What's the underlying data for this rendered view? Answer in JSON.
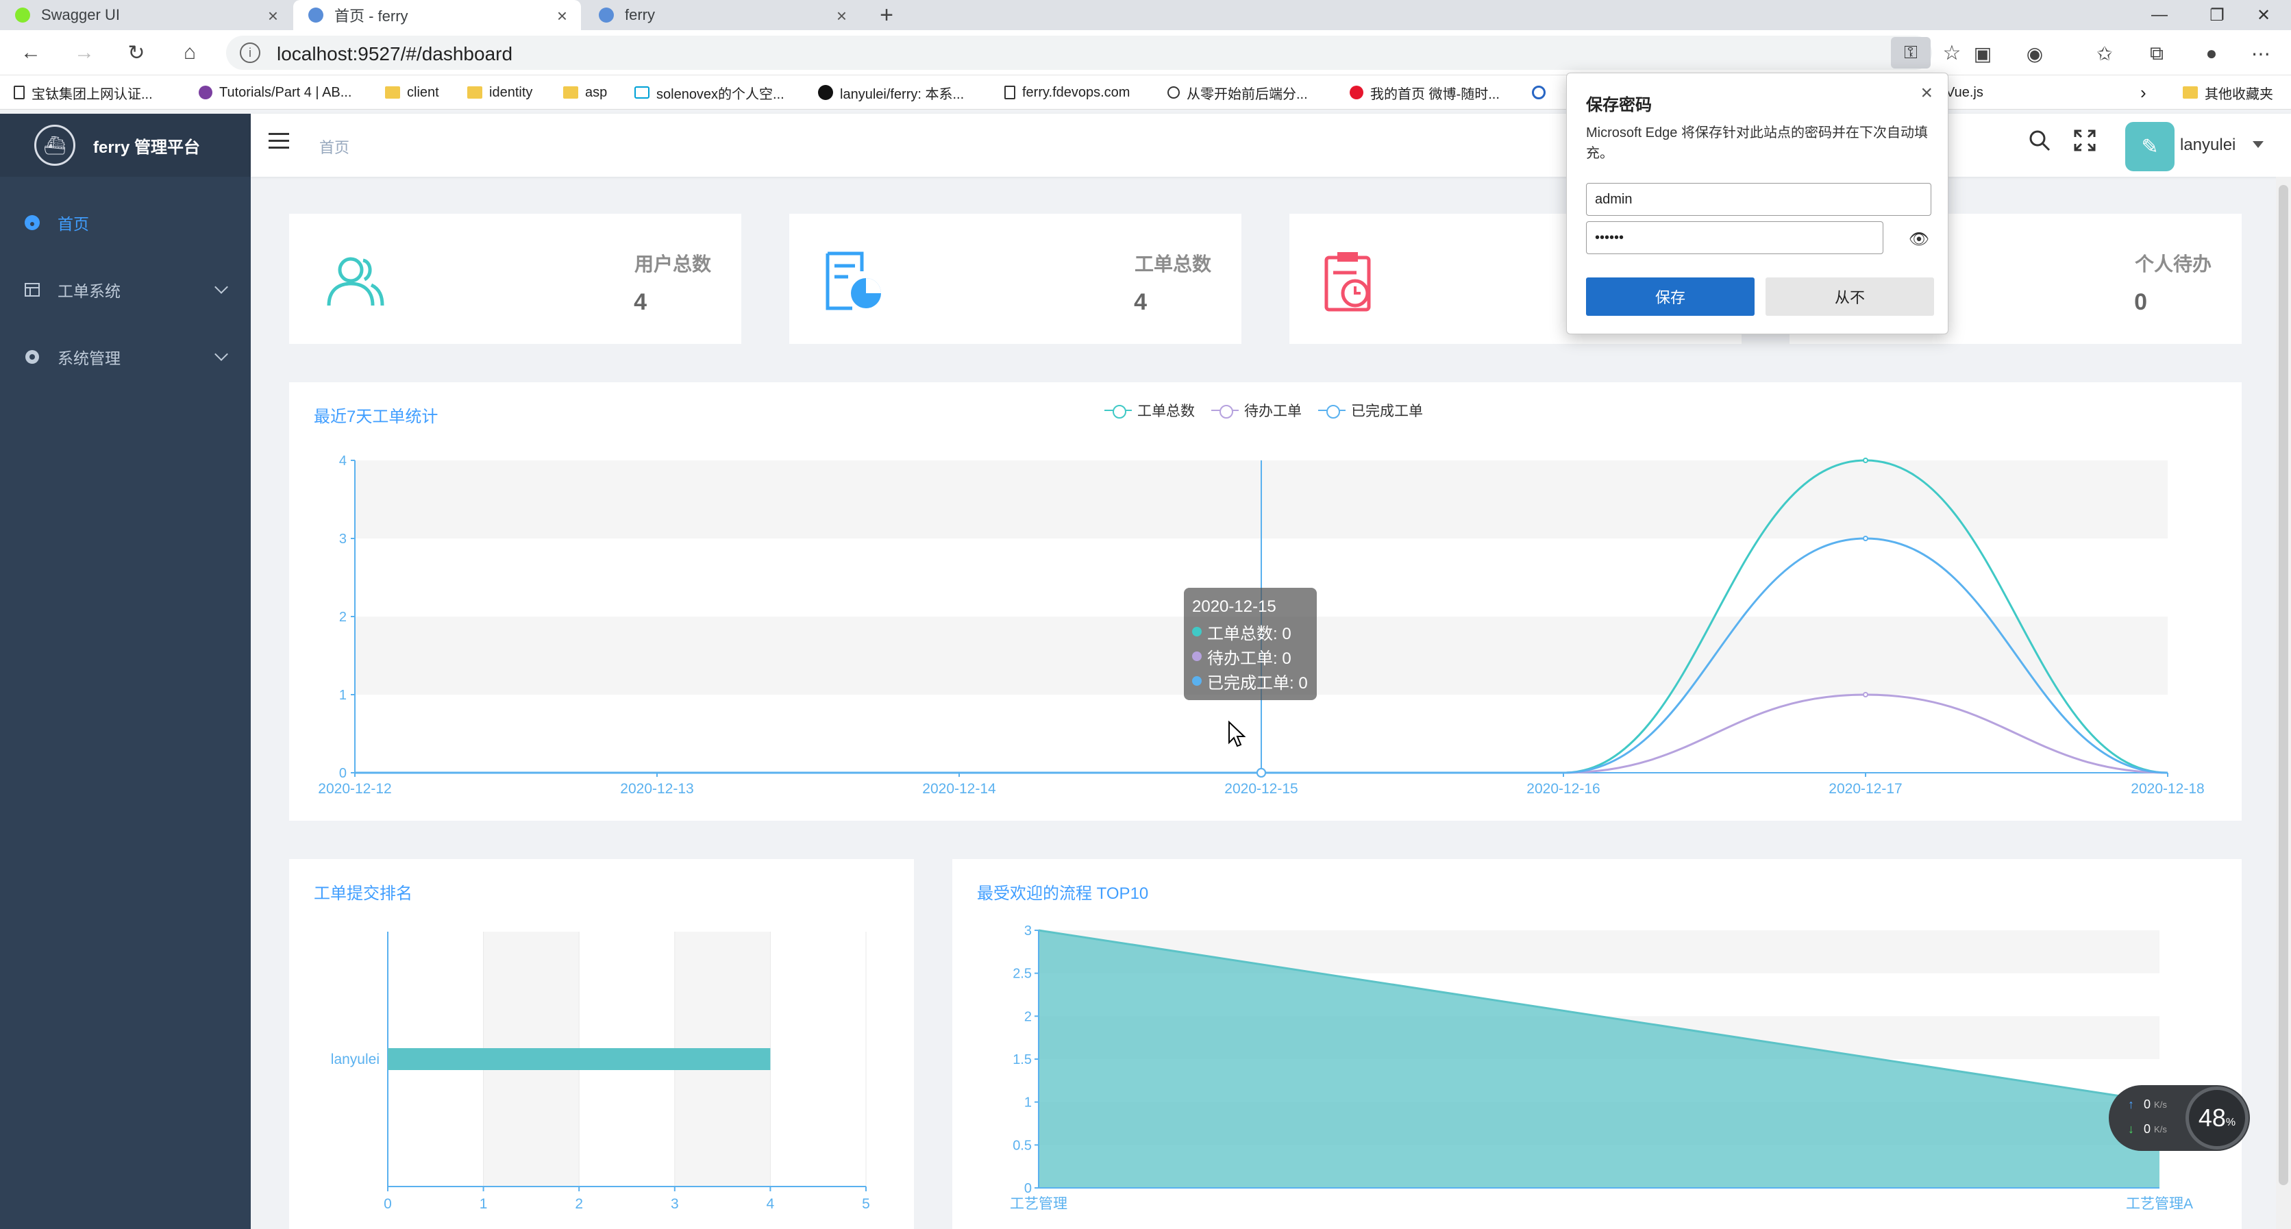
{
  "browser": {
    "tabs": [
      {
        "label": "Swagger UI",
        "active": false,
        "favicon_color": "#85ea2d"
      },
      {
        "label": "首页 - ferry",
        "active": true,
        "favicon_color": "#5a8ed8"
      },
      {
        "label": "ferry",
        "active": false,
        "favicon_color": "#5a8ed8"
      }
    ],
    "url": "localhost:9527/#/dashboard",
    "bookmarks": [
      {
        "label": "宝钛集团上网认证...",
        "icon": "page-icon"
      },
      {
        "label": "Tutorials/Part 4 | AB...",
        "icon": "circle-icon"
      },
      {
        "label": "client",
        "icon": "folder-icon"
      },
      {
        "label": "identity",
        "icon": "folder-icon"
      },
      {
        "label": "asp",
        "icon": "folder-icon"
      },
      {
        "label": "solenovex的个人空...",
        "icon": "bilibili-icon"
      },
      {
        "label": "lanyulei/ferry: 本系...",
        "icon": "github-icon"
      },
      {
        "label": "ferry.fdevops.com",
        "icon": "page-icon"
      },
      {
        "label": "从零开始前后端分...",
        "icon": "link-icon"
      },
      {
        "label": "我的首页 微博-随时...",
        "icon": "weibo-icon"
      },
      {
        "label": "Vue.js",
        "icon": "vue-icon"
      },
      {
        "label": "其他收藏夹",
        "icon": "folder-icon"
      }
    ]
  },
  "app": {
    "logo_title": "ferry 管理平台",
    "menu": [
      {
        "label": "首页",
        "active": true,
        "has_children": false
      },
      {
        "label": "工单系统",
        "active": false,
        "has_children": true
      },
      {
        "label": "系统管理",
        "active": false,
        "has_children": true
      }
    ],
    "breadcrumb": "首页",
    "username": "lanyulei"
  },
  "stats": [
    {
      "label": "用户总数",
      "value": "4",
      "icon": "users-icon",
      "color": "#40c9c6"
    },
    {
      "label": "工单总数",
      "value": "4",
      "icon": "document-chart-icon",
      "color": "#36a3f7"
    },
    {
      "label": "",
      "value": "",
      "icon": "clipboard-clock-icon",
      "color": "#f4516c"
    },
    {
      "label": "个人待办",
      "value": "0",
      "icon": "todo-icon",
      "color": "#34bfa3"
    }
  ],
  "panels": {
    "line_title": "最近7天工单统计",
    "bar_title": "工单提交排名",
    "area_title": "最受欢迎的流程 TOP10"
  },
  "tooltip": {
    "title": "2020-12-15",
    "rows": [
      {
        "label": "工单总数: 0",
        "color": "#40c9c6"
      },
      {
        "label": "待办工单: 0",
        "color": "#b6a2de"
      },
      {
        "label": "已完成工单: 0",
        "color": "#5ab1ef"
      }
    ]
  },
  "password_dialog": {
    "title": "保存密码",
    "description": "Microsoft Edge 将保存针对此站点的密码并在下次自动填充。",
    "username_value": "admin",
    "password_value": "••••••",
    "save_label": "保存",
    "never_label": "从不"
  },
  "network_widget": {
    "upload": "0",
    "download": "0",
    "unit": "K/s",
    "percent": "48",
    "percent_unit": "%"
  },
  "chart_data": [
    {
      "type": "line",
      "title": "最近7天工单统计",
      "x": [
        "2020-12-12",
        "2020-12-13",
        "2020-12-14",
        "2020-12-15",
        "2020-12-16",
        "2020-12-17",
        "2020-12-18"
      ],
      "ylim": [
        0,
        4
      ],
      "yticks": [
        0,
        1,
        2,
        3,
        4
      ],
      "smooth": true,
      "grid": "banded",
      "legend_position": "top-center",
      "series": [
        {
          "name": "工单总数",
          "values": [
            0,
            0,
            0,
            0,
            0,
            4,
            0
          ],
          "color": "#40c9c6"
        },
        {
          "name": "待办工单",
          "values": [
            0,
            0,
            0,
            0,
            0,
            1,
            0
          ],
          "color": "#b6a2de"
        },
        {
          "name": "已完成工单",
          "values": [
            0,
            0,
            0,
            0,
            0,
            3,
            0
          ],
          "color": "#5ab1ef"
        }
      ]
    },
    {
      "type": "bar",
      "orientation": "horizontal",
      "title": "工单提交排名",
      "categories": [
        "lanyulei"
      ],
      "values": [
        4
      ],
      "xlim": [
        0,
        5
      ],
      "xticks": [
        0,
        1,
        2,
        3,
        4,
        5
      ],
      "color": "#5cc3c7"
    },
    {
      "type": "area",
      "title": "最受欢迎的流程 TOP10",
      "x": [
        "工艺管理",
        "工艺管理A"
      ],
      "values": [
        3,
        1
      ],
      "ylim": [
        0,
        3
      ],
      "yticks": [
        "0",
        "0.5",
        "1",
        "1.5",
        "2",
        "2.5",
        "3"
      ],
      "color": "#5cc3c7"
    }
  ]
}
